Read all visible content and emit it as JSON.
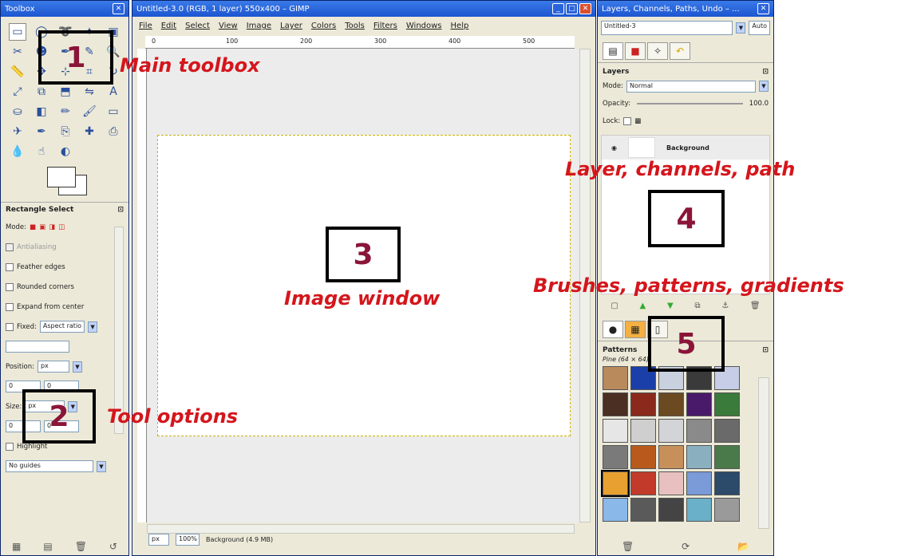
{
  "toolbox": {
    "title": "Toolbox",
    "tools": [
      "rect-select",
      "ellipse-select",
      "free-select",
      "fuzzy-select",
      "color-select",
      "scissors",
      "foreground-select",
      "paths",
      "color-picker",
      "zoom",
      "measure",
      "move",
      "align",
      "crop",
      "rotate",
      "scale",
      "shear",
      "perspective",
      "flip",
      "text",
      "bucket-fill",
      "blend",
      "pencil",
      "paintbrush",
      "eraser",
      "airbrush",
      "ink",
      "clone",
      "heal",
      "perspective-clone",
      "blur",
      "smudge",
      "dodge-burn"
    ],
    "tool_glyphs": [
      "▭",
      "◯",
      "➰",
      "✦",
      "▣",
      "✂",
      "☻",
      "✒",
      "✎",
      "🔍",
      "📏",
      "✥",
      "⊹",
      "⌗",
      "↻",
      "⤢",
      "⧉",
      "⬒",
      "⇋",
      "A",
      "⛀",
      "◧",
      "✏",
      "🖌",
      "▭",
      "✈",
      "✒",
      "⎘",
      "✚",
      "⎙",
      "💧",
      "☝",
      "◐"
    ],
    "options_title": "Rectangle Select",
    "mode_label": "Mode:",
    "antialiasing_label": "Antialiasing",
    "feather_label": "Feather edges",
    "rounded_label": "Rounded corners",
    "expand_label": "Expand from center",
    "fixed_label": "Fixed:",
    "fixed_value": "Aspect ratio",
    "position_label": "Position:",
    "position_unit": "px",
    "position_x": "0",
    "position_y": "0",
    "size_label": "Size:",
    "size_unit": "px",
    "size_w": "0",
    "size_h": "0",
    "highlight_label": "Highlight",
    "guides_value": "No guides"
  },
  "imagewin": {
    "title": "Untitled-3.0 (RGB, 1 layer) 550x400 – GIMP",
    "menu": [
      "File",
      "Edit",
      "Select",
      "View",
      "Image",
      "Layer",
      "Colors",
      "Tools",
      "Filters",
      "Windows",
      "Help"
    ],
    "ruler_ticks": [
      "0",
      "100",
      "200",
      "300",
      "400",
      "500"
    ],
    "unit": "px",
    "zoom": "100%",
    "status": "Background (4.9 MB)"
  },
  "dock": {
    "title": "Layers, Channels, Paths, Undo – ...",
    "image_selector": "Untitled-3",
    "auto_label": "Auto",
    "layers_title": "Layers",
    "mode_label": "Mode:",
    "mode_value": "Normal",
    "opacity_label": "Opacity:",
    "opacity_value": "100.0",
    "lock_label": "Lock:",
    "layer_name": "Background",
    "patterns_title": "Patterns",
    "pattern_info": "Pine (64 × 64)",
    "pattern_colors": [
      "#b88a5c",
      "#1b3fa8",
      "#c9d1df",
      "#3a3a3a",
      "#c7cde6",
      "#4a2f22",
      "#8a2a1c",
      "#6b4a22",
      "#4a1a6a",
      "#3a7a3a",
      "#e6e6e6",
      "#cfcfcf",
      "#d2d4d8",
      "#8a8a8a",
      "#6a6a6a",
      "#7a7a7a",
      "#b85a1c",
      "#c7905a",
      "#8ab0c0",
      "#4a7a4a",
      "#e8a030",
      "#c23a2a",
      "#e8c0c0",
      "#7a9ad8",
      "#2c4a6a",
      "#8ab8e8",
      "#5a5a5a",
      "#444444",
      "#6ab0c8",
      "#9a9a9a"
    ]
  },
  "annotations": {
    "box1": "1",
    "box2": "2",
    "box3": "3",
    "box4": "4",
    "box5": "5",
    "label1": "Main toolbox",
    "label2": "Tool options",
    "label3": "Image window",
    "label4": "Layer, channels, path",
    "label5": "Brushes, patterns, gradients"
  }
}
